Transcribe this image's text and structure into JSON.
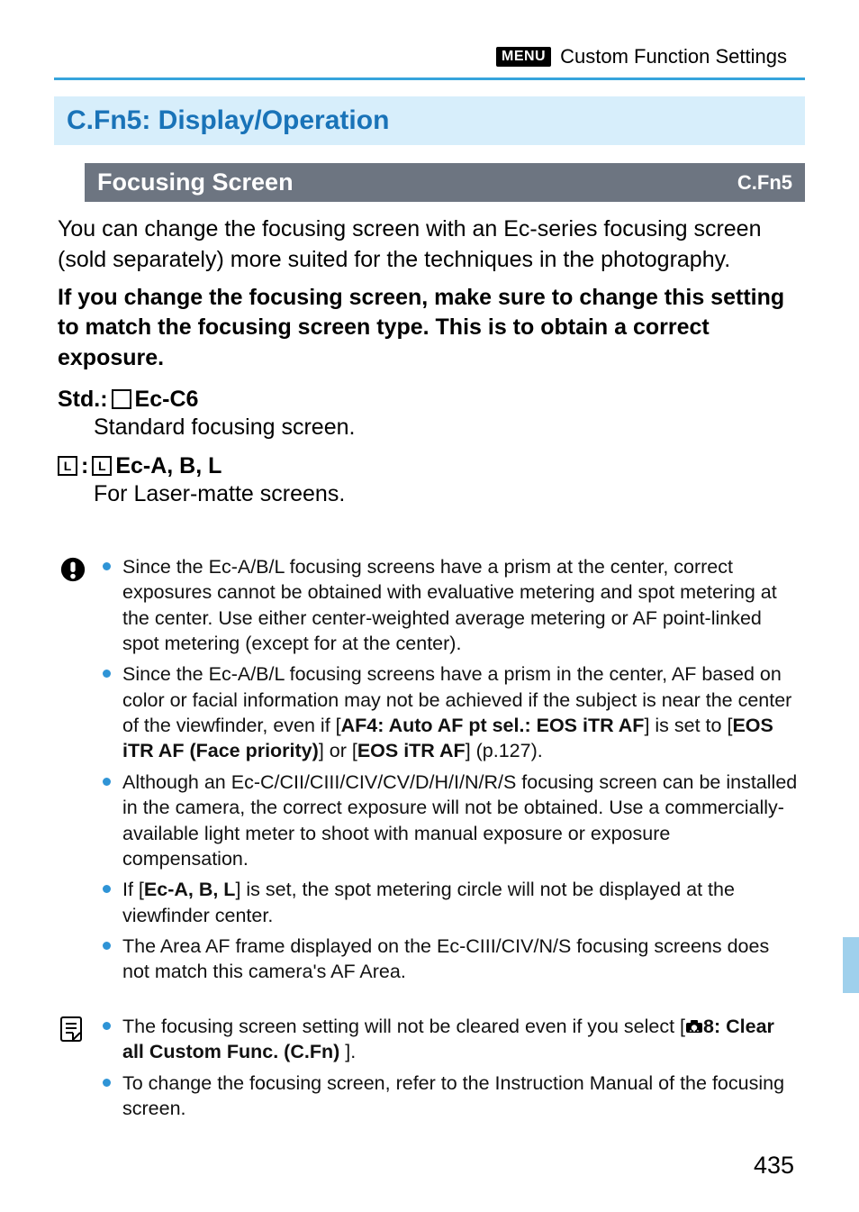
{
  "breadcrumb": {
    "menu_label": "MENU",
    "text": "Custom Function Settings"
  },
  "section": {
    "title": "C.Fn5: Display/Operation"
  },
  "subhead": {
    "title": "Focusing Screen",
    "right": "C.Fn5"
  },
  "intro": {
    "p1": "You can change the focusing screen with an Ec-series focusing screen (sold separately) more suited for the techniques in the photography.",
    "p2_bold": "If you change the focusing screen, make sure to change this setting to match the focusing screen type. This is to obtain a correct exposure."
  },
  "options": {
    "a_prefix": "Std.:",
    "a_glyph": "",
    "a_label": "Ec-C6",
    "a_desc": "Standard focusing screen.",
    "b_glyph_left": "L",
    "b_sep": ":",
    "b_glyph_right": "L",
    "b_label": "Ec-A, B, L",
    "b_desc": "For Laser-matte screens."
  },
  "caution": {
    "items": [
      "Since the Ec-A/B/L focusing screens have a prism at the center, correct exposures cannot be obtained with evaluative metering and spot metering at the center. Use either center-weighted average metering or AF point-linked spot metering (except for at the center).",
      "__AF4__",
      "Although an Ec-C/CII/CIII/CIV/CV/D/H/I/N/R/S focusing screen can be installed in the camera, the correct exposure will not be obtained. Use a commercially-available light meter to shoot with manual exposure or exposure compensation.",
      "__ECABL__",
      "The Area AF frame displayed on the Ec-CIII/CIV/N/S focusing screens does not match this camera's AF Area."
    ],
    "af4_pre": "Since the Ec-A/B/L focusing screens have a prism in the center, AF based on color or facial information may not be achieved if the subject is near the center of the viewfinder, even if [",
    "af4_bold1": "AF4: Auto AF pt sel.: EOS iTR AF",
    "af4_mid1": "] is set to [",
    "af4_bold2": "EOS iTR AF (Face priority)",
    "af4_mid2": "] or [",
    "af4_bold3": "EOS iTR AF",
    "af4_post": "] (p.127).",
    "ecabl_pre": "If [",
    "ecabl_bold": "Ec-A, B,  L",
    "ecabl_post": "] is set, the spot metering circle will not be displayed at the viewfinder center."
  },
  "info": {
    "item1_pre": "The focusing screen setting will not be cleared even if you select [",
    "item1_bold_tail": "8: Clear all Custom Func. (C.Fn) ",
    "item1_post": "].",
    "item2": "To change the focusing screen, refer to the Instruction Manual of the focusing screen."
  },
  "page_number": "435"
}
